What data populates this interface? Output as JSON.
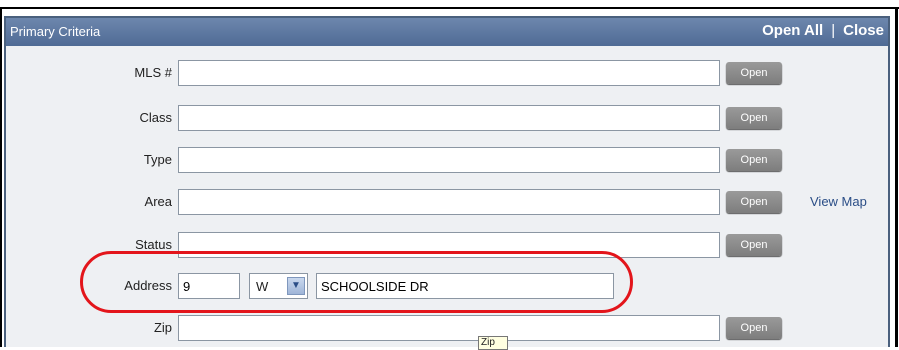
{
  "panel": {
    "title": "Primary Criteria",
    "open_all": "Open All",
    "separator": "|",
    "close": "Close"
  },
  "rows": [
    {
      "label": "MLS #",
      "value": "",
      "button": "Open"
    },
    {
      "label": "Class",
      "value": "",
      "button": "Open"
    },
    {
      "label": "Type",
      "value": "",
      "button": "Open"
    },
    {
      "label": "Area",
      "value": "",
      "button": "Open",
      "link": "View Map"
    },
    {
      "label": "Status",
      "value": "",
      "button": "Open"
    },
    {
      "label": "Zip",
      "value": "",
      "button": "Open"
    }
  ],
  "address": {
    "label": "Address",
    "number": "9",
    "direction": "W",
    "street": "SCHOOLSIDE DR"
  },
  "tooltip": "Zip"
}
